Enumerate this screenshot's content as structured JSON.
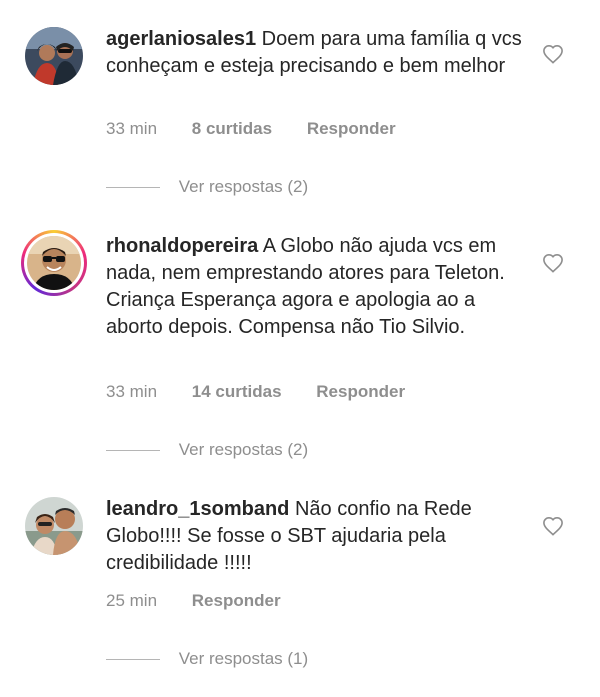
{
  "comments": [
    {
      "username": "agerlaniosales1",
      "text": "Doem para uma família q vcs conheçam e esteja precisando e bem melhor",
      "time": "33 min",
      "likes": "8 curtidas",
      "reply": "Responder",
      "view_replies": "Ver respostas (2)"
    },
    {
      "username": "rhonaldopereira",
      "text": "A Globo não ajuda vcs em nada, nem emprestando atores para Teleton. Criança Esperança agora e apologia ao a aborto depois. Compensa não Tio Silvio.",
      "time": "33 min",
      "likes": "14 curtidas",
      "reply": "Responder",
      "view_replies": "Ver respostas (2)"
    },
    {
      "username": "leandro_1somband",
      "text": "Não confio na Rede Globo!!!! Se fosse o SBT ajudaria pela credibilidade !!!!!",
      "time": "25 min",
      "reply": "Responder",
      "view_replies": "Ver respostas (1)"
    }
  ]
}
